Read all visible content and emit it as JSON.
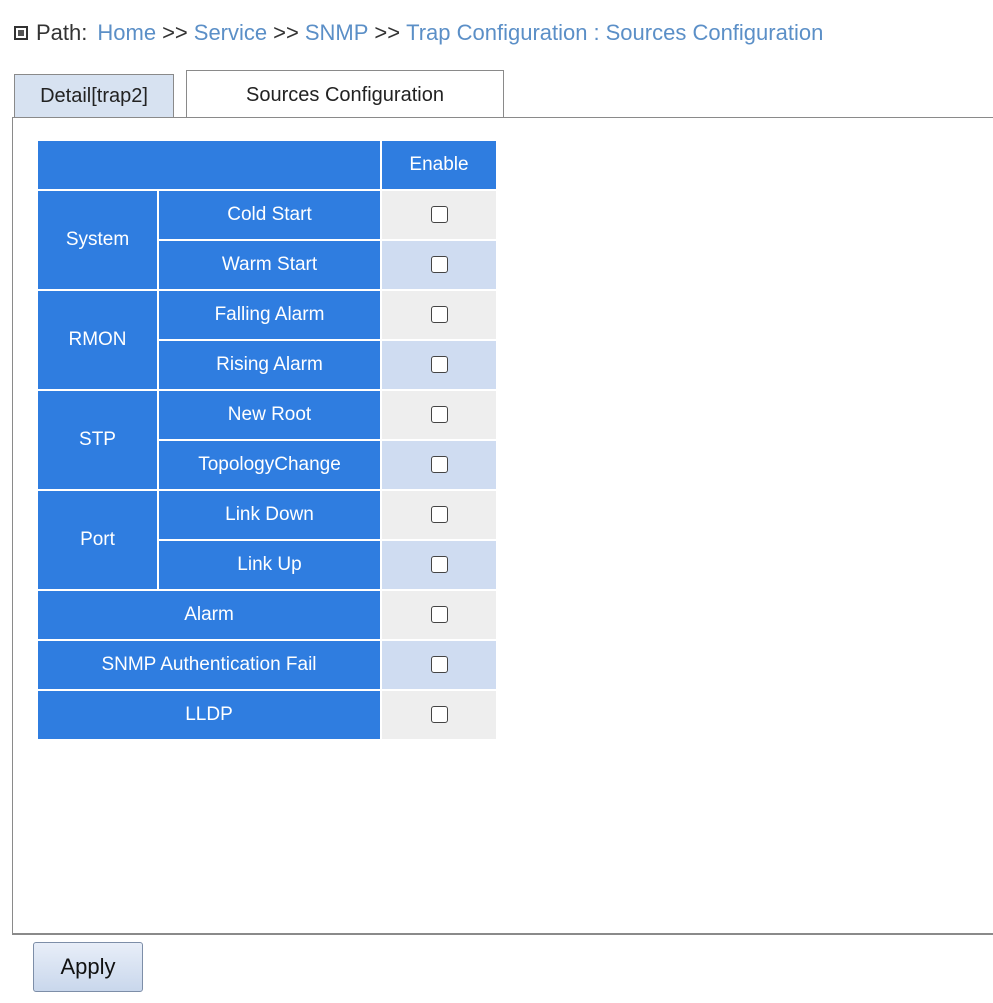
{
  "path": {
    "label": "Path:",
    "crumbs": [
      "Home",
      "Service",
      "SNMP",
      "Trap Configuration"
    ],
    "separator": ">>",
    "page_sep": ":",
    "current": "Sources Configuration"
  },
  "tabs": [
    {
      "label": "Detail[trap2]",
      "active": false
    },
    {
      "label": "Sources Configuration",
      "active": true
    }
  ],
  "table": {
    "enable_header": "Enable",
    "groups": [
      {
        "name": "System",
        "items": [
          "Cold Start",
          "Warm Start"
        ]
      },
      {
        "name": "RMON",
        "items": [
          "Falling Alarm",
          "Rising Alarm"
        ]
      },
      {
        "name": "STP",
        "items": [
          "New Root",
          "TopologyChange"
        ]
      },
      {
        "name": "Port",
        "items": [
          "Link Down",
          "Link Up"
        ]
      }
    ],
    "single_rows": [
      "Alarm",
      "SNMP Authentication Fail",
      "LLDP"
    ]
  },
  "apply_label": "Apply",
  "colors": {
    "header_blue": "#2f7de0",
    "row_alt_blue": "#cfdcf1",
    "row_gray": "#eeeeee",
    "link": "#5b8fc7"
  }
}
